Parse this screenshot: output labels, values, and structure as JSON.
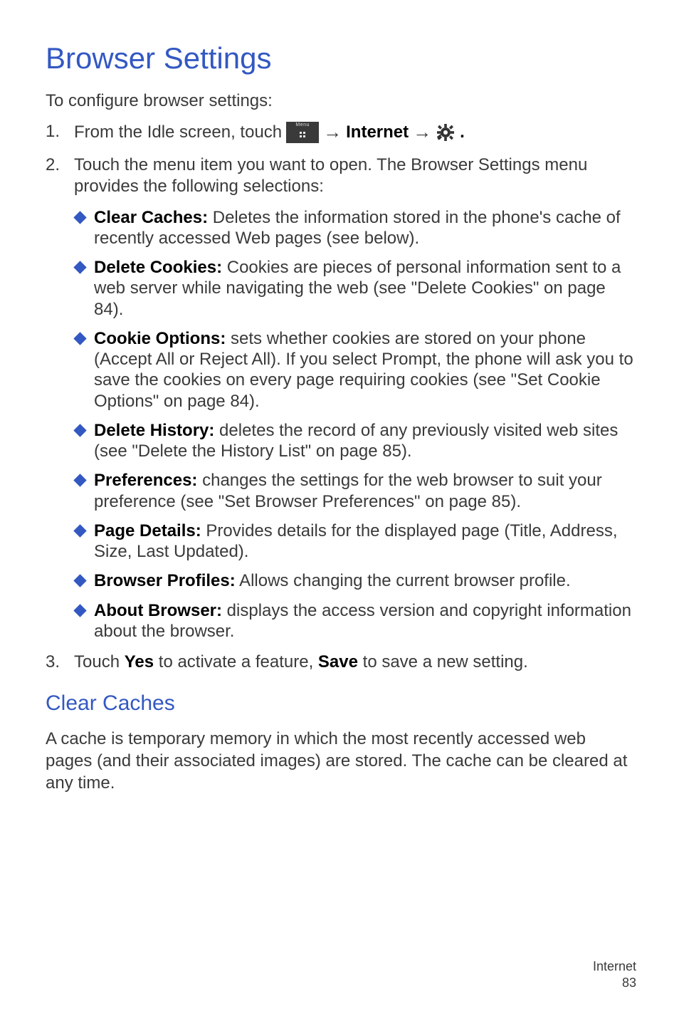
{
  "h1": "Browser Settings",
  "intro": "To configure browser settings:",
  "step1_prefix": "From the Idle screen, touch",
  "menu_icon_label": "Menu",
  "arrow": "→",
  "internet_label": "Internet",
  "period": ".",
  "step2": "Touch the menu item you want to open. The Browser Settings menu provides the following selections:",
  "items": [
    {
      "title": "Clear Caches:",
      "body": " Deletes the information stored in the phone's cache of recently accessed Web pages (see below)."
    },
    {
      "title": "Delete Cookies:",
      "body": " Cookies are pieces of personal information sent to a web server while navigating the web (see \"Delete Cookies\" on page 84)."
    },
    {
      "title": "Cookie Options:",
      "body": " sets whether cookies are stored on your phone (Accept All or Reject All). If you select Prompt, the phone will ask you to save the cookies on every page requiring cookies (see \"Set Cookie Options\" on page 84)."
    },
    {
      "title": "Delete History:",
      "body": " deletes the record of any previously visited web sites (see \"Delete the History List\" on page 85)."
    },
    {
      "title": "Preferences:",
      "body": " changes the settings for the web browser to suit your preference (see \"Set Browser Preferences\" on page 85)."
    },
    {
      "title": "Page Details:",
      "body": " Provides details for the displayed page (Title, Address, Size, Last Updated)."
    },
    {
      "title": "Browser Profiles:",
      "body": " Allows changing the current browser profile."
    },
    {
      "title": "About Browser:",
      "body": " displays the access version and copyright information about the browser."
    }
  ],
  "step3_pre": "Touch ",
  "step3_yes": "Yes",
  "step3_mid": " to activate a feature, ",
  "step3_save": "Save",
  "step3_post": " to save a new setting.",
  "h2": "Clear Caches",
  "para": "A cache is temporary memory in which the most recently accessed web pages (and their associated images) are stored. The cache can be cleared at any time.",
  "footer_label": "Internet",
  "footer_page": "83"
}
